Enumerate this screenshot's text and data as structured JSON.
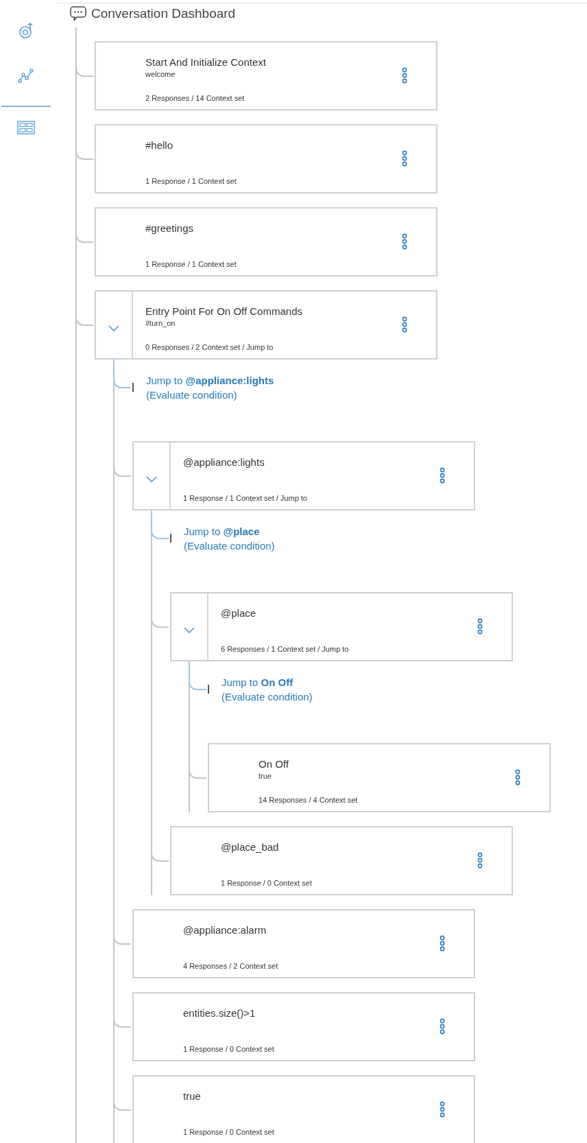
{
  "header": {
    "title": "Conversation Dashboard"
  },
  "nodes": [
    {
      "kind": "node",
      "title": "Start And Initialize Context",
      "condition": "welcome",
      "summary": "2 Responses / 14 Context set"
    },
    {
      "kind": "node",
      "title": "#hello",
      "summary": "1 Response / 1 Context set"
    },
    {
      "kind": "node",
      "title": "#greetings",
      "summary": "1 Response / 1 Context set"
    },
    {
      "kind": "node",
      "title": "Entry Point For On Off Commands",
      "condition": "#turn_on",
      "summary": "0 Responses / 2 Context set / Jump to",
      "expanded": true,
      "children": [
        {
          "kind": "jump",
          "label": "Jump to **@appliance:lights**",
          "note": "(Evaluate condition)"
        },
        {
          "kind": "node",
          "title": "@appliance:lights",
          "summary": "1 Response / 1 Context set / Jump to",
          "expanded": true,
          "children": [
            {
              "kind": "jump",
              "label": "Jump to **@place**",
              "note": "(Evaluate condition)"
            },
            {
              "kind": "node",
              "title": "@place",
              "summary": "6 Responses / 1 Context set / Jump to",
              "expanded": true,
              "children": [
                {
                  "kind": "jump",
                  "label": "Jump to **On Off**",
                  "note": "(Evaluate condition)"
                },
                {
                  "kind": "node",
                  "title": "On Off",
                  "condition": "true",
                  "summary": "14 Responses / 4 Context set"
                }
              ]
            },
            {
              "kind": "node",
              "title": "@place_bad",
              "summary": "1 Response / 0 Context set"
            }
          ]
        },
        {
          "kind": "node",
          "title": "@appliance:alarm",
          "summary": "4 Responses / 2 Context set"
        },
        {
          "kind": "node",
          "title": "entities.size()>1",
          "summary": "1 Response / 0 Context set"
        },
        {
          "kind": "node",
          "title": "true",
          "summary": "1 Response / 0 Context set"
        }
      ]
    }
  ]
}
